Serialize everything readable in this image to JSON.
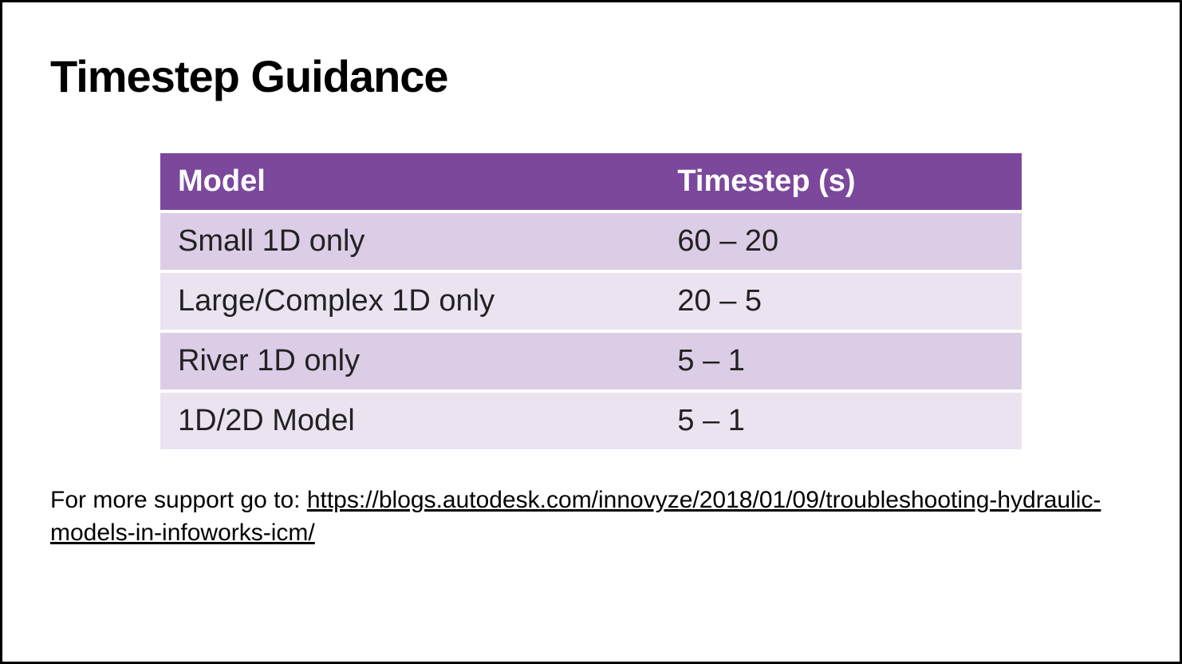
{
  "title": "Timestep Guidance",
  "table": {
    "headers": [
      "Model",
      "Timestep (s)"
    ],
    "rows": [
      {
        "model": "Small 1D only",
        "timestep": "60 – 20"
      },
      {
        "model": "Large/Complex 1D only",
        "timestep": "20 – 5"
      },
      {
        "model": "River 1D only",
        "timestep": "5 – 1"
      },
      {
        "model": "1D/2D Model",
        "timestep": "5 – 1"
      }
    ]
  },
  "footnote": {
    "prefix": "For more support go to: ",
    "link_text": "https://blogs.autodesk.com/innovyze/2018/01/09/troubleshooting-hydraulic-models-in-infoworks-icm/"
  }
}
